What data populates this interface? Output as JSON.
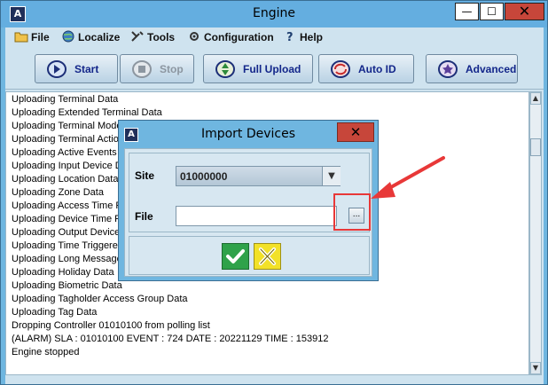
{
  "window": {
    "title": "Engine",
    "logo_text": "A",
    "controls": {
      "minimize": "—",
      "maximize": "☐",
      "close": "✕"
    }
  },
  "menu": [
    {
      "label": "File",
      "icon": "folder-icon"
    },
    {
      "label": "Localize",
      "icon": "globe-icon"
    },
    {
      "label": "Tools",
      "icon": "tools-icon"
    },
    {
      "label": "Configuration",
      "icon": "gear-icon"
    },
    {
      "label": "Help",
      "icon": "question-icon"
    }
  ],
  "toolbar": {
    "start": "Start",
    "stop": "Stop",
    "full_upload": "Full Upload",
    "auto_id": "Auto ID",
    "advanced": "Advanced"
  },
  "log": {
    "lines": [
      "Uploading Terminal Data",
      "Uploading Extended Terminal Data",
      "Uploading Terminal Mode",
      "Uploading Terminal Action",
      "Uploading Active Events",
      "Uploading Input Device D",
      "Uploading Location Data",
      "Uploading Zone Data",
      "Uploading Access Time F",
      "Uploading Device Time Pa",
      "Uploading Output Device",
      "Uploading Time Triggered",
      "Uploading Long Message",
      "Uploading Holiday Data",
      "Uploading Biometric Data",
      "Uploading Tagholder Access Group Data",
      "Uploading Tag Data",
      "Dropping Controller 01010100 from polling list",
      "(ALARM) SLA : 01010100 EVENT : 724 DATE : 20221129 TIME : 153912",
      "Engine stopped"
    ]
  },
  "dialog": {
    "title": "Import Devices",
    "logo_text": "A",
    "close": "✕",
    "site_label": "Site",
    "site_value": "01000000",
    "file_label": "File",
    "file_value": "",
    "browse_label": "..."
  },
  "colors": {
    "title_bar": "#64aee0",
    "close_red": "#c7463a",
    "ok_green": "#2fa24a",
    "cancel_yellow": "#f2e128",
    "annotation_red": "#e83838"
  }
}
